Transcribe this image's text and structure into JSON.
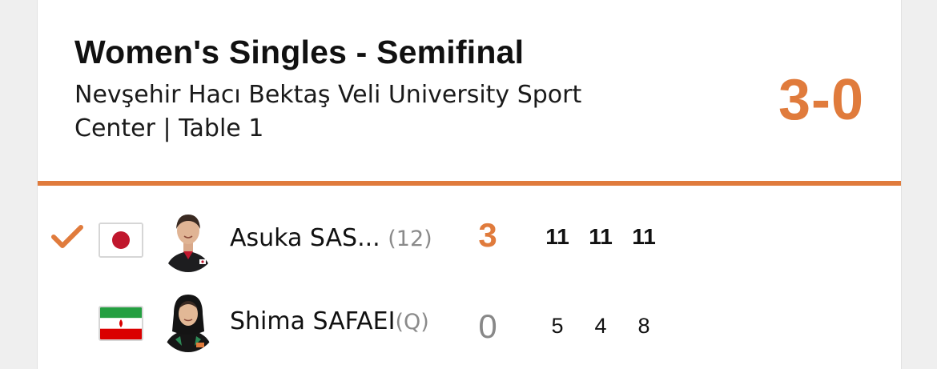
{
  "match": {
    "title": "Women's Singles - Semifinal",
    "venue": "Nevşehir Hacı Bektaş Veli University Sport Center | Table 1",
    "final_score": "3-0",
    "accent_color": "#e07b3c"
  },
  "players": [
    {
      "winner_icon": "checkmark-icon",
      "flag_icon": "japan-flag-icon",
      "avatar": "player-photo",
      "name": "Asuka SAS...",
      "seed": "(12)",
      "sets": "3",
      "games": [
        "11",
        "11",
        "11"
      ]
    },
    {
      "flag_icon": "iran-flag-icon",
      "avatar": "player-photo",
      "name": "Shima SAFAEI",
      "seed": "(Q)",
      "sets": "0",
      "games": [
        "5",
        "4",
        "8"
      ]
    }
  ]
}
